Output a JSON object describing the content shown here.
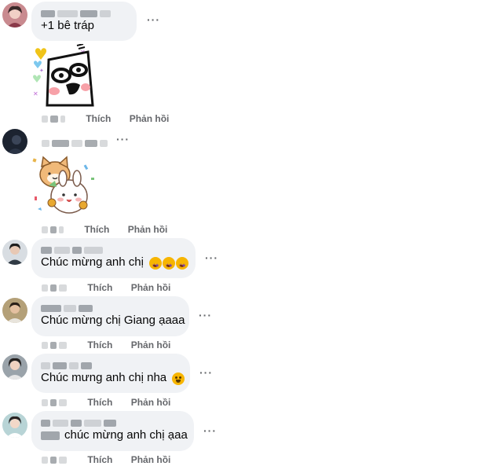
{
  "comments": [
    {
      "text": "+1 bê tráp",
      "like_label": "Thích",
      "reply_label": "Phản hồi",
      "more_icon": "ellipsis-icon"
    },
    {
      "text": "",
      "sticker": "dog-and-bunny-celebration-sticker",
      "like_label": "Thích",
      "reply_label": "Phản hồi"
    },
    {
      "text": "Chúc mừng anh chị",
      "emoji": "star-struck-emoji x3",
      "like_label": "Thích",
      "reply_label": "Phản hồi"
    },
    {
      "text": "Chúc mừng chị Giang ạaaa",
      "like_label": "Thích",
      "reply_label": "Phản hồi"
    },
    {
      "text": "Chúc mưng anh chị nha",
      "emoji": "grinning-emoji",
      "like_label": "Thích",
      "reply_label": "Phản hồi"
    },
    {
      "text": "chúc mừng anh chị ạaa",
      "like_label": "Thích",
      "reply_label": "Phản hồi"
    }
  ],
  "first_sticker": "cartoon-face-hearts-sticker",
  "colors": {
    "bubble": "#f0f2f5",
    "action_text": "#65676b",
    "text": "#050505"
  }
}
